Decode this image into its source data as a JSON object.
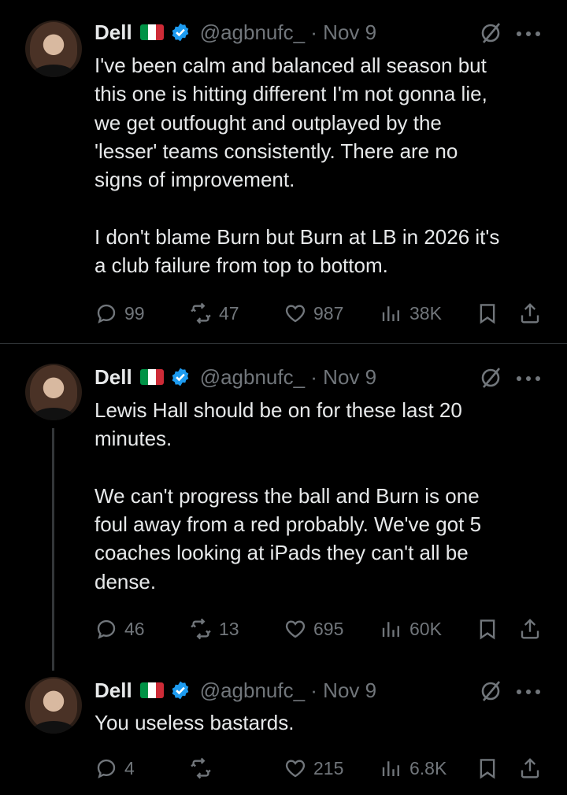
{
  "tweets": [
    {
      "name": "Dell",
      "handle": "@agbnufc_ · Nov 9",
      "text": "I've been calm and balanced all season but\nthis one is hitting different I'm not gonna lie,\nwe get outfought and outplayed by the\n'lesser' teams consistently. There are no\nsigns of improvement.\n\nI don't blame Burn but Burn at LB in 2026 it's\na club failure from top to bottom.",
      "replies": "99",
      "retweets": "47",
      "likes": "987",
      "views": "38K"
    },
    {
      "name": "Dell",
      "handle": "@agbnufc_ · Nov 9",
      "text": "Lewis Hall should be on for these last 20\nminutes.\n\nWe can't progress the ball and Burn is one\nfoul away from a red probably. We've got 5\ncoaches looking at iPads they can't all be\ndense.",
      "replies": "46",
      "retweets": "13",
      "likes": "695",
      "views": "60K"
    },
    {
      "name": "Dell",
      "handle": "@agbnufc_ · Nov 9",
      "text": "You useless bastards.",
      "replies": "4",
      "retweets": "",
      "likes": "215",
      "views": "6.8K"
    }
  ],
  "icons": {
    "reply": "reply-icon",
    "retweet": "retweet-icon",
    "like": "heart-icon",
    "views": "views-icon",
    "bookmark": "bookmark-icon",
    "share": "share-icon",
    "grok": "slash-circle-icon",
    "more": "more-icon",
    "verified": "verified-badge-icon",
    "flag": "italy-flag-icon"
  },
  "colors": {
    "background": "#000000",
    "text": "#e7e9ea",
    "muted": "#71767b",
    "verified": "#1d9bf0",
    "divider": "#2f3336"
  }
}
